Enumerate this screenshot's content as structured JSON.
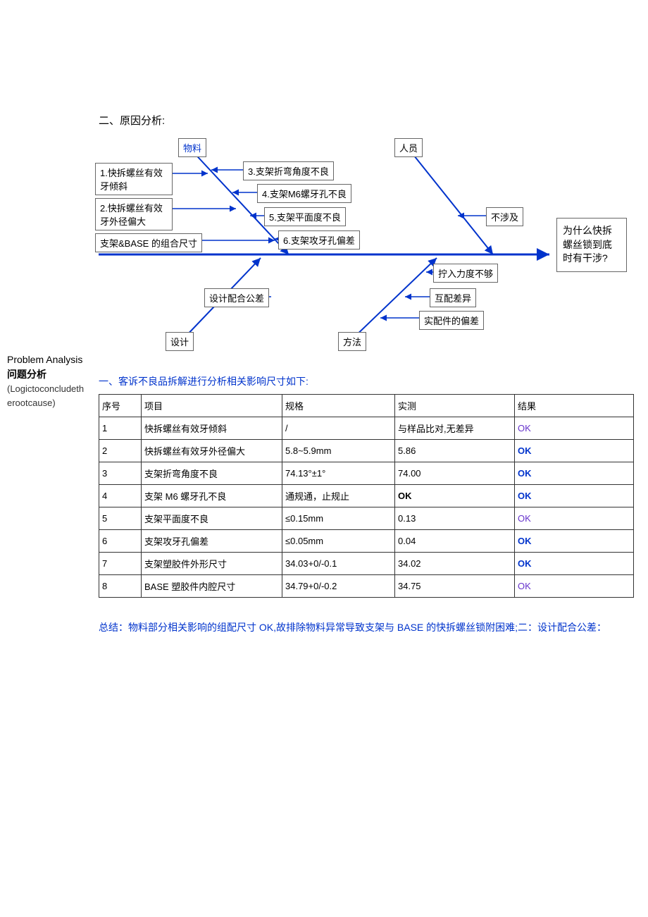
{
  "sidebar": {
    "problem_analysis_en": "Problem Analysis",
    "problem_analysis_cn": "问题分析",
    "logic": "(Logictoconcludetherootcause)"
  },
  "header_section2": "二、原因分析:",
  "fishbone": {
    "categories": {
      "material": "物料",
      "personnel": "人员",
      "design": "设计",
      "method": "方法"
    },
    "material_branches": {
      "b1": "1.快拆螺丝有效牙倾斜",
      "b2": "2.快拆螺丝有效牙外径偏大",
      "b3": "3.支架折弯角度不良",
      "b4": "4.支架M6螺牙孔不良",
      "b5": "5.支架平面度不良",
      "b6": "6.支架攻牙孔偏差",
      "b7": "支架&BASE 的组合尺寸"
    },
    "personnel_branches": {
      "p1": "不涉及"
    },
    "design_branches": {
      "d1": "设计配合公差"
    },
    "method_branches": {
      "m1": "拧入力度不够",
      "m2": "互配差异",
      "m3": "实配件的偏差"
    },
    "problem": "为什么快拆螺丝锁到底时有干涉?"
  },
  "subsection1": "一、客诉不良品拆解进行分析相关影响尺寸如下:",
  "table": {
    "headers": {
      "seq": "序号",
      "item": "项目",
      "spec": "规格",
      "measured": "实测",
      "result": "结果"
    },
    "rows": [
      {
        "seq": "1",
        "item": "快拆螺丝有效牙倾斜",
        "spec": "/",
        "measured": "与样品比对,无差异",
        "result": "OK",
        "style": "purple"
      },
      {
        "seq": "2",
        "item": "快拆螺丝有效牙外径偏大",
        "spec": "5.8~5.9mm",
        "measured": "5.86",
        "result": "OK",
        "style": "blue"
      },
      {
        "seq": "3",
        "item": "支架折弯角度不良",
        "spec": "74.13°±1°",
        "measured": "74.00",
        "result": "OK",
        "style": "blue"
      },
      {
        "seq": "4",
        "item": "支架 M6 螺牙孔不良",
        "spec": "通规通，止规止",
        "measured": "OK",
        "result": "OK",
        "style": "blue",
        "measured_bold": true
      },
      {
        "seq": "5",
        "item": "支架平面度不良",
        "spec": "≤0.15mm",
        "measured": "0.13",
        "result": "OK",
        "style": "purple"
      },
      {
        "seq": "6",
        "item": "支架攻牙孔偏差",
        "spec": "≤0.05mm",
        "measured": "0.04",
        "result": "OK",
        "style": "blue"
      },
      {
        "seq": "7",
        "item": "支架塑胶件外形尺寸",
        "spec": "34.03+0/-0.1",
        "measured": "34.02",
        "result": "OK",
        "style": "blue"
      },
      {
        "seq": "8",
        "item": "BASE 塑胶件内腔尺寸",
        "spec": "34.79+0/-0.2",
        "measured": "34.75",
        "result": "OK",
        "style": "purple"
      }
    ]
  },
  "summary": "总结：物料部分相关影响的组配尺寸 OK,故排除物料异常导致支架与 BASE 的快拆螺丝锁附困难;二：设计配合公差："
}
